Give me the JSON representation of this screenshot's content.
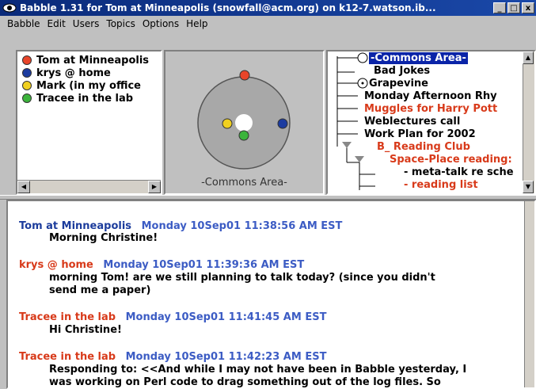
{
  "window": {
    "title": "Babble 1.31 for Tom at Minneapolis (snowfall@acm.org)  on k12-7.watson.ib..."
  },
  "menu": [
    "Babble",
    "Edit",
    "Users",
    "Topics",
    "Options",
    "Help"
  ],
  "users": [
    {
      "name": "Tom at Minneapolis",
      "color": "#e8452a"
    },
    {
      "name": "krys @ home",
      "color": "#1c3ca0"
    },
    {
      "name": "Mark (in my office",
      "color": "#f0d020"
    },
    {
      "name": "Tracee in the lab",
      "color": "#3cb43c"
    }
  ],
  "room": {
    "label": "-Commons Area-"
  },
  "topics": [
    {
      "label": "-Commons Area-",
      "selected": true
    },
    {
      "label": "Bad Jokes"
    },
    {
      "label": "Grapevine"
    },
    {
      "label": "Monday Afternoon Rhy"
    },
    {
      "label": "Muggles for Harry Pott",
      "red": true
    },
    {
      "label": "Weblectures call"
    },
    {
      "label": "Work Plan for 2002"
    },
    {
      "label": "B_ Reading Club",
      "red": true
    },
    {
      "label": "Space-Place reading:",
      "red": true
    },
    {
      "label": "- meta-talk re sche"
    },
    {
      "label": "- reading list",
      "red": true
    }
  ],
  "messages": [
    {
      "user": "Tom at Minneapolis",
      "time": "Monday 10Sep01 11:38:56 AM EST",
      "lines": [
        "Morning Christine!"
      ],
      "color": "blue"
    },
    {
      "user": "krys @ home",
      "time": "Monday 10Sep01 11:39:36 AM EST",
      "lines": [
        "morning Tom! are we still planning to talk today?  (since you didn't",
        "send me a paper)"
      ],
      "color": "red"
    },
    {
      "user": "Tracee in the lab",
      "time": "Monday 10Sep01 11:41:45 AM EST",
      "lines": [
        "Hi Christine!"
      ],
      "color": "red"
    },
    {
      "user": "Tracee in the lab",
      "time": "Monday 10Sep01 11:42:23 AM EST",
      "lines": [
        "Responding to: <<And while I may not have been in Babble yesterday, I",
        "was working on Perl code to drag something out of the log files.  So"
      ],
      "color": "red"
    }
  ]
}
